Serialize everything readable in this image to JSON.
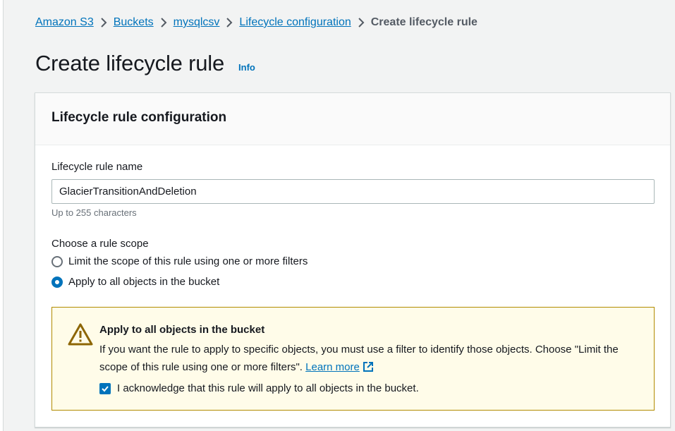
{
  "breadcrumb": {
    "items": [
      "Amazon S3",
      "Buckets",
      "mysqlcsv",
      "Lifecycle configuration"
    ],
    "current": "Create lifecycle rule"
  },
  "header": {
    "title": "Create lifecycle rule",
    "info_label": "Info"
  },
  "panel": {
    "title": "Lifecycle rule configuration",
    "rule_name": {
      "label": "Lifecycle rule name",
      "value": "GlacierTransitionAndDeletion",
      "hint": "Up to 255 characters"
    },
    "scope": {
      "label": "Choose a rule scope",
      "options": [
        {
          "label": "Limit the scope of this rule using one or more filters",
          "selected": false
        },
        {
          "label": "Apply to all objects in the bucket",
          "selected": true
        }
      ]
    },
    "warning": {
      "title": "Apply to all objects in the bucket",
      "text": "If you want the rule to apply to specific objects, you must use a filter to identify those objects. Choose \"Limit the scope of this rule using one or more filters\".",
      "link": "Learn more",
      "ack_label": "I acknowledge that this rule will apply to all objects in the bucket.",
      "ack_checked": true
    }
  },
  "colors": {
    "link": "#0073bb",
    "warning_border": "#b28b00",
    "warning_bg": "#fffce9",
    "warning_icon": "#8d6605"
  }
}
